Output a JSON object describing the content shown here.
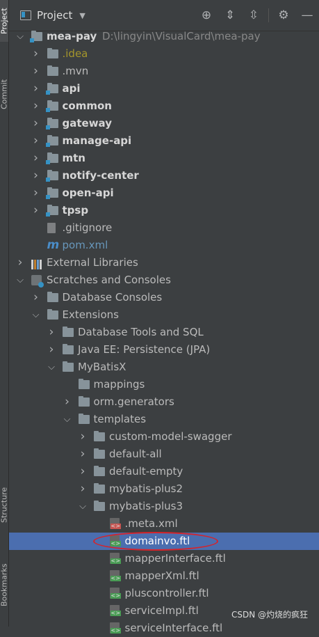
{
  "side_tabs": {
    "project": "Project",
    "commit": "Commit",
    "structure": "Structure",
    "bookmarks": "Bookmarks"
  },
  "toolbar": {
    "title": "Project",
    "icons": [
      "locate-icon",
      "expand-all-icon",
      "collapse-all-icon",
      "gear-icon",
      "minimize-icon"
    ]
  },
  "tree": [
    {
      "label": "mea-pay",
      "hint": "D:\\lingyin\\VisualCard\\mea-pay",
      "bold": true,
      "arrow": "down"
    },
    {
      "label": ".idea",
      "color": "#a5962b",
      "arrow": "right"
    },
    {
      "label": ".mvn",
      "arrow": "right"
    },
    {
      "label": "api",
      "bold": true,
      "arrow": "right"
    },
    {
      "label": "common",
      "bold": true,
      "arrow": "right"
    },
    {
      "label": "gateway",
      "bold": true,
      "arrow": "right"
    },
    {
      "label": "manage-api",
      "bold": true,
      "arrow": "right"
    },
    {
      "label": "mtn",
      "bold": true,
      "arrow": "right"
    },
    {
      "label": "notify-center",
      "bold": true,
      "arrow": "right"
    },
    {
      "label": "open-api",
      "bold": true,
      "arrow": "right"
    },
    {
      "label": "tpsp",
      "bold": true,
      "arrow": "right"
    },
    {
      "label": ".gitignore"
    },
    {
      "label": "pom.xml",
      "color": "#6897bb"
    },
    {
      "label": "External Libraries",
      "arrow": "right"
    },
    {
      "label": "Scratches and Consoles",
      "arrow": "down"
    },
    {
      "label": "Database Consoles",
      "arrow": "right"
    },
    {
      "label": "Extensions",
      "arrow": "down"
    },
    {
      "label": "Database Tools and SQL",
      "arrow": "right"
    },
    {
      "label": "Java EE: Persistence (JPA)",
      "arrow": "right"
    },
    {
      "label": "MyBatisX",
      "arrow": "down"
    },
    {
      "label": "mappings"
    },
    {
      "label": "orm.generators",
      "arrow": "right"
    },
    {
      "label": "templates",
      "arrow": "down"
    },
    {
      "label": "custom-model-swagger",
      "arrow": "right"
    },
    {
      "label": "default-all",
      "arrow": "right"
    },
    {
      "label": "default-empty",
      "arrow": "right"
    },
    {
      "label": "mybatis-plus2",
      "arrow": "right"
    },
    {
      "label": "mybatis-plus3",
      "arrow": "down"
    },
    {
      "label": ".meta.xml"
    },
    {
      "label": "domainvo.ftl",
      "selected": true
    },
    {
      "label": "mapperInterface.ftl"
    },
    {
      "label": "mapperXml.ftl"
    },
    {
      "label": "pluscontroller.ftl"
    },
    {
      "label": "serviceImpl.ftl"
    },
    {
      "label": "serviceInterface.ftl"
    }
  ],
  "watermark": "CSDN @灼烧的疯狂"
}
